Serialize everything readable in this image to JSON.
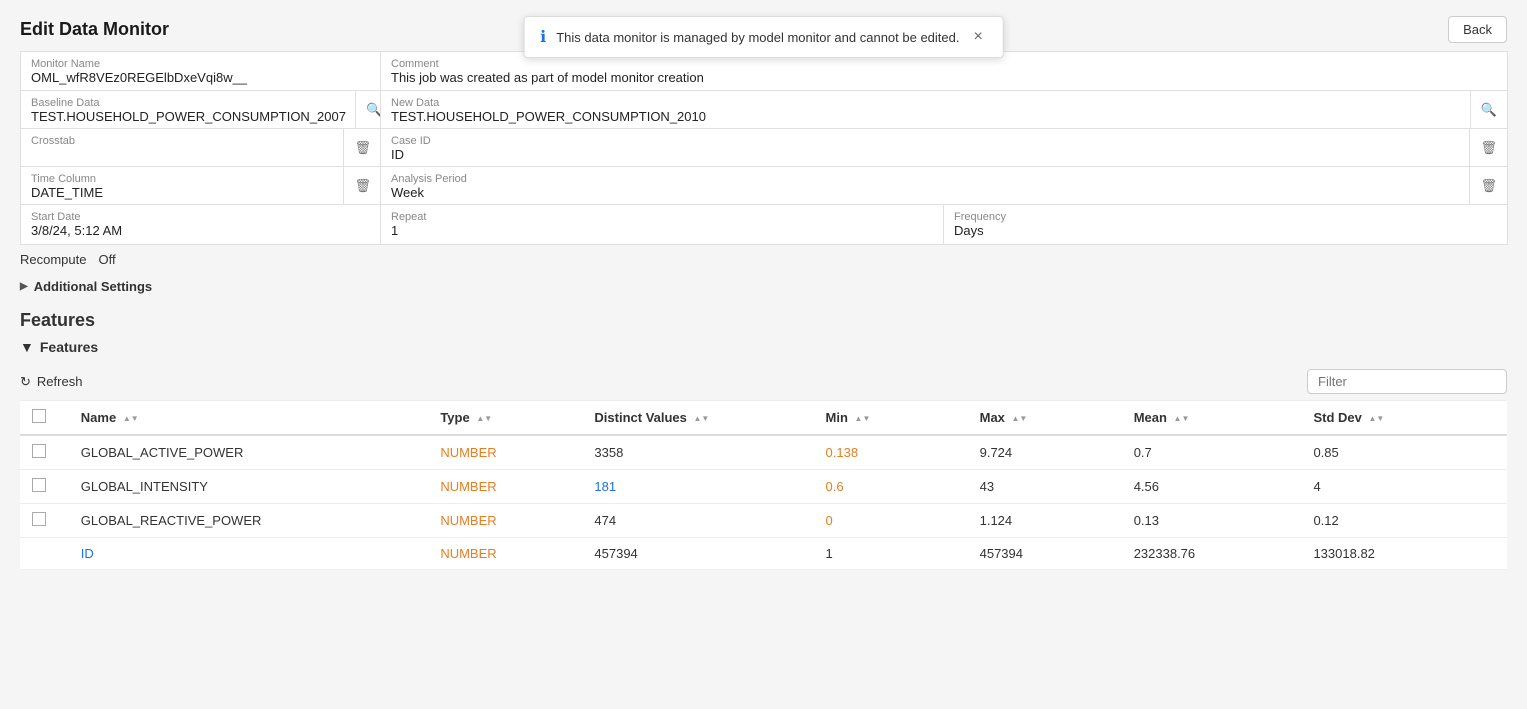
{
  "page": {
    "title": "Edit Data Monitor",
    "back_label": "Back"
  },
  "toast": {
    "text": "This data monitor is managed by model monitor and cannot be edited.",
    "close": "×"
  },
  "form": {
    "monitor_name_label": "Monitor Name",
    "monitor_name_value": "OML_wfR8VEz0REGElbDxeVqi8w__",
    "comment_label": "Comment",
    "comment_value": "This job was created as part of model monitor creation",
    "baseline_data_label": "Baseline Data",
    "baseline_data_value": "TEST.HOUSEHOLD_POWER_CONSUMPTION_2007",
    "new_data_label": "New Data",
    "new_data_value": "TEST.HOUSEHOLD_POWER_CONSUMPTION_2010",
    "crosstab_label": "Crosstab",
    "crosstab_value": "",
    "case_id_label": "Case ID",
    "case_id_value": "ID",
    "time_column_label": "Time Column",
    "time_column_value": "DATE_TIME",
    "analysis_period_label": "Analysis Period",
    "analysis_period_value": "Week",
    "start_date_label": "Start Date",
    "start_date_value": "3/8/24, 5:12 AM",
    "repeat_label": "Repeat",
    "repeat_value": "1",
    "frequency_label": "Frequency",
    "frequency_value": "Days",
    "recompute_label": "Recompute",
    "recompute_value": "Off"
  },
  "additional_settings": {
    "label": "Additional Settings"
  },
  "features": {
    "title": "Features",
    "expand_label": "Features",
    "refresh_label": "Refresh",
    "filter_placeholder": "Filter"
  },
  "table": {
    "columns": [
      {
        "id": "name",
        "label": "Name"
      },
      {
        "id": "type",
        "label": "Type"
      },
      {
        "id": "distinct_values",
        "label": "Distinct Values"
      },
      {
        "id": "min",
        "label": "Min"
      },
      {
        "id": "max",
        "label": "Max"
      },
      {
        "id": "mean",
        "label": "Mean"
      },
      {
        "id": "std_dev",
        "label": "Std Dev"
      }
    ],
    "rows": [
      {
        "name": "GLOBAL_ACTIVE_POWER",
        "type": "NUMBER",
        "distinct_values": "3358",
        "min": "0.138",
        "max": "9.724",
        "mean": "0.7",
        "std_dev": "0.85",
        "min_highlight": true
      },
      {
        "name": "GLOBAL_INTENSITY",
        "type": "NUMBER",
        "distinct_values": "181",
        "min": "0.6",
        "max": "43",
        "mean": "4.56",
        "std_dev": "4",
        "distinct_highlight": true,
        "min_highlight": true
      },
      {
        "name": "GLOBAL_REACTIVE_POWER",
        "type": "NUMBER",
        "distinct_values": "474",
        "min": "0",
        "max": "1.124",
        "mean": "0.13",
        "std_dev": "0.12",
        "min_highlight": true
      },
      {
        "name": "ID",
        "type": "NUMBER",
        "distinct_values": "457394",
        "min": "1",
        "max": "457394",
        "mean": "232338.76",
        "std_dev": "133018.82"
      }
    ]
  }
}
